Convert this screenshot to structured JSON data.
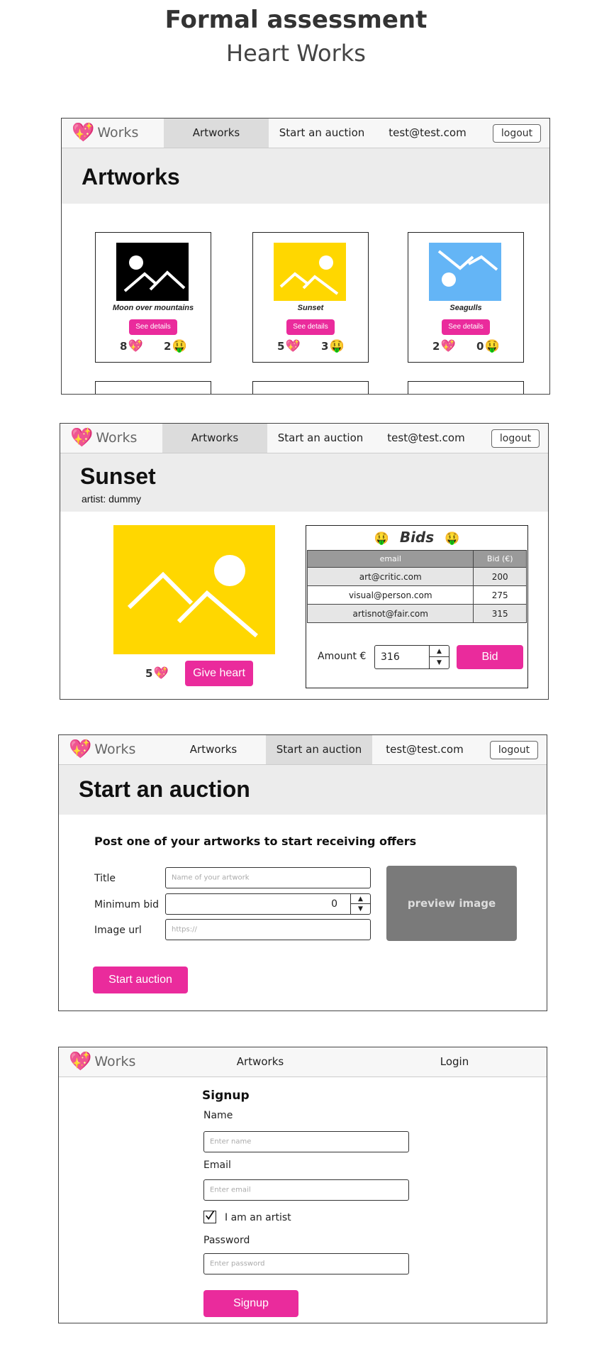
{
  "header": {
    "title": "Formal assessment",
    "subtitle": "Heart Works"
  },
  "colors": {
    "accent": "#ea2b9c",
    "banner": "#ececec",
    "yellow": "#ffd700",
    "blue": "#64b5f6",
    "black": "#000000"
  },
  "nav": {
    "brand": "Works",
    "brand_icon": "sparkling-heart-icon",
    "artworks": "Artworks",
    "start_auction": "Start an auction",
    "user": "test@test.com",
    "logout": "logout",
    "login": "Login"
  },
  "artworks_page": {
    "title": "Artworks",
    "details_label": "See details",
    "cards": [
      {
        "name": "Moon over mountains",
        "hearts": "8",
        "bids": "2",
        "thumb": "black"
      },
      {
        "name": "Sunset",
        "hearts": "5",
        "bids": "3",
        "thumb": "yellow"
      },
      {
        "name": "Seagulls",
        "hearts": "2",
        "bids": "0",
        "thumb": "blue"
      }
    ]
  },
  "detail_page": {
    "title": "Sunset",
    "artist": "artist: dummy",
    "hearts": "5",
    "give_heart": "Give heart",
    "bids_title": "Bids",
    "columns": [
      "email",
      "Bid (€)"
    ],
    "bids": [
      {
        "email": "art@critic.com",
        "bid": "200"
      },
      {
        "email": "visual@person.com",
        "bid": "275"
      },
      {
        "email": "artisnot@fair.com",
        "bid": "315"
      }
    ],
    "amount_label": "Amount €",
    "amount_value": "316",
    "bid_button": "Bid"
  },
  "auction_page": {
    "title": "Start an auction",
    "subtitle": "Post one of your artworks to start receiving offers",
    "title_label": "Title",
    "title_placeholder": "Name of your artwork",
    "min_bid_label": "Minimum bid",
    "min_bid_value": "0",
    "url_label": "Image url",
    "url_placeholder": "https://",
    "preview": "preview image",
    "submit": "Start auction"
  },
  "signup_page": {
    "title": "Signup",
    "name_label": "Name",
    "name_placeholder": "Enter name",
    "email_label": "Email",
    "email_placeholder": "Enter email",
    "artist_label": "I am an artist",
    "artist_checked": true,
    "password_label": "Password",
    "password_placeholder": "Enter password",
    "submit": "Signup"
  }
}
